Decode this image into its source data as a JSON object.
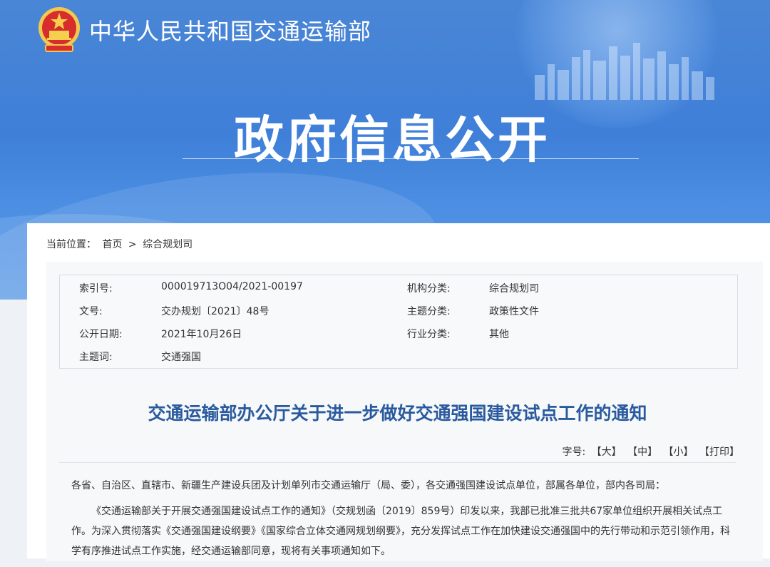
{
  "header": {
    "org_name": "中华人民共和国交通运输部",
    "portal_title": "政府信息公开"
  },
  "breadcrumb": {
    "label": "当前位置：",
    "home": "首页",
    "separator": ">",
    "current": "综合规划司"
  },
  "meta": {
    "rows": [
      {
        "k1": "索引号:",
        "v1": "000019713O04/2021-00197",
        "k2": "机构分类:",
        "v2": "综合规划司"
      },
      {
        "k1": "文号:",
        "v1": "交办规划〔2021〕48号",
        "k2": "主题分类:",
        "v2": "政策性文件"
      },
      {
        "k1": "公开日期:",
        "v1": "2021年10月26日",
        "k2": "行业分类:",
        "v2": "其他"
      },
      {
        "k1": "主题词:",
        "v1": "交通强国",
        "k2": "",
        "v2": ""
      }
    ]
  },
  "document": {
    "title": "交通运输部办公厅关于进一步做好交通强国建设试点工作的通知",
    "fontbar": {
      "label": "字号:",
      "large": "【大】",
      "medium": "【中】",
      "small": "【小】",
      "print": "【打印】"
    },
    "salutation": "各省、自治区、直辖市、新疆生产建设兵团及计划单列市交通运输厅（局、委），各交通强国建设试点单位，部属各单位，部内各司局：",
    "paragraph1": "《交通运输部关于开展交通强国建设试点工作的通知》（交规划函〔2019〕859号）印发以来，我部已批准三批共67家单位组织开展相关试点工作。为深入贯彻落实《交通强国建设纲要》《国家综合立体交通网规划纲要》，充分发挥试点工作在加快建设交通强国中的先行带动和示范引领作用，科学有序推进试点工作实施，经交通运输部同意，现将有关事项通知如下。"
  }
}
